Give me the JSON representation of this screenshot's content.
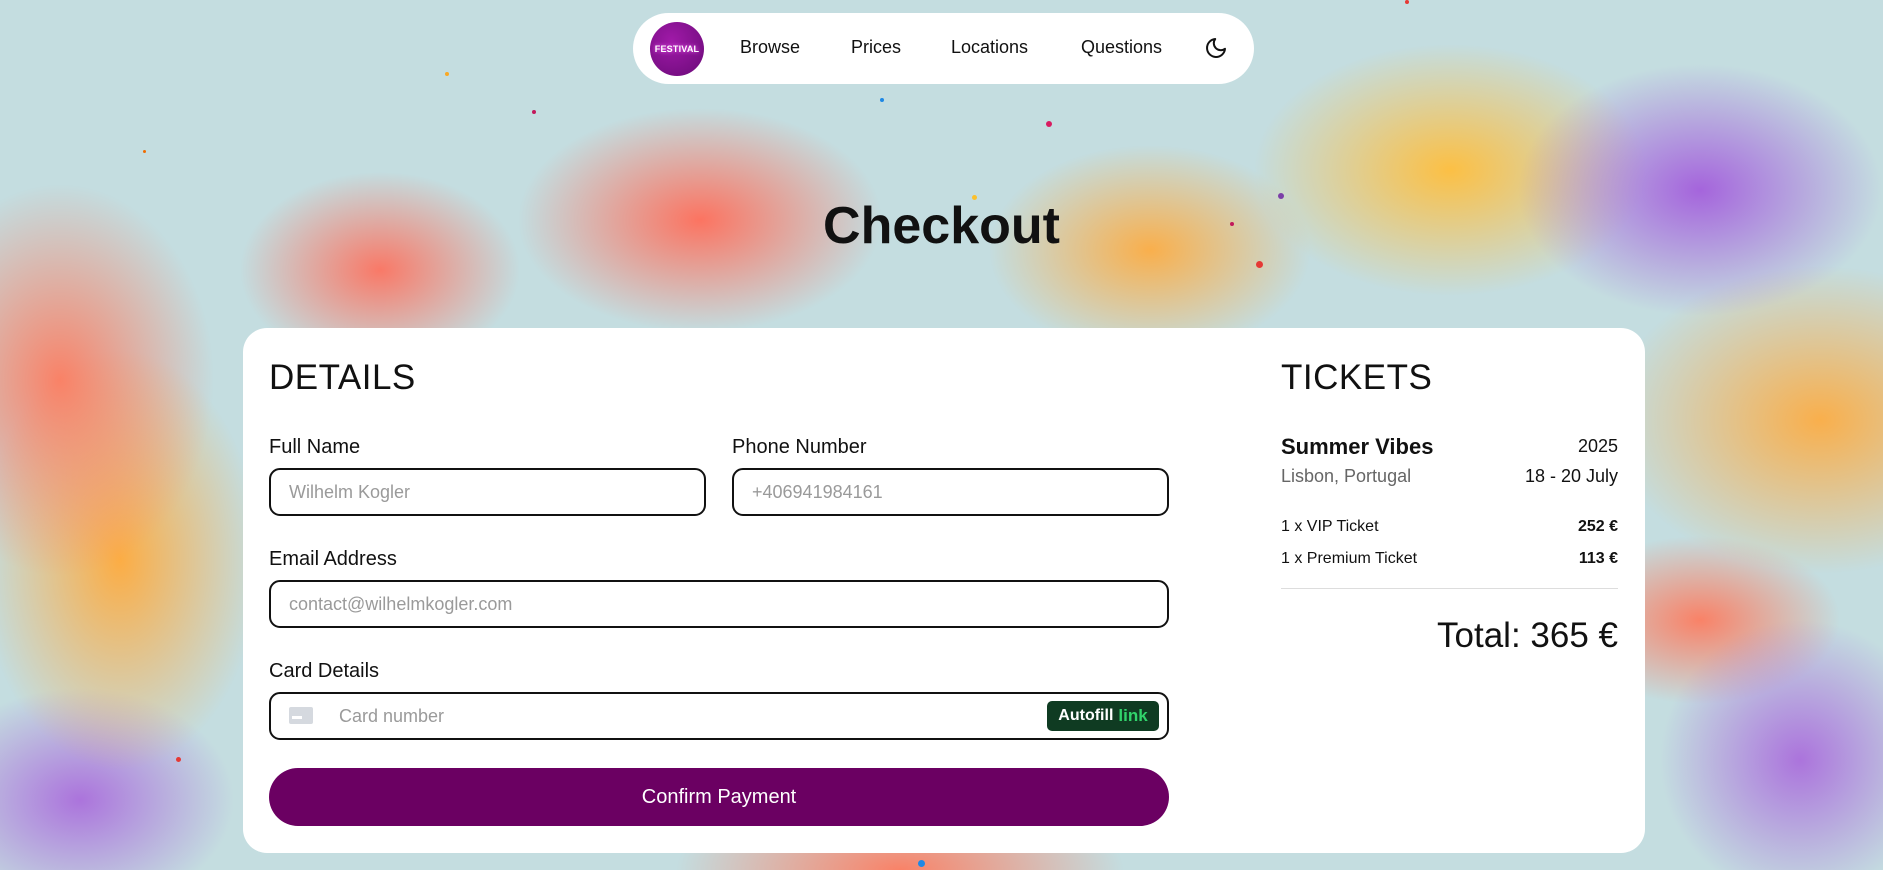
{
  "nav": {
    "logo_text": "FESTIVAL",
    "links": [
      "Browse",
      "Prices",
      "Locations",
      "Questions"
    ],
    "theme_icon": "moon-icon"
  },
  "page": {
    "title": "Checkout"
  },
  "details": {
    "title": "DETAILS",
    "full_name": {
      "label": "Full Name",
      "placeholder": "Wilhelm Kogler"
    },
    "phone": {
      "label": "Phone Number",
      "placeholder": "+406941984161"
    },
    "email": {
      "label": "Email Address",
      "placeholder": "contact@wilhelmkogler.com"
    },
    "card": {
      "label": "Card Details",
      "placeholder": "Card number",
      "autofill_text": "Autofill",
      "autofill_link": "link"
    },
    "confirm_label": "Confirm Payment"
  },
  "tickets": {
    "title": "TICKETS",
    "event_name": "Summer Vibes",
    "year": "2025",
    "location": "Lisbon, Portugal",
    "dates": "18 - 20 July",
    "items": [
      {
        "label": "1 x VIP Ticket",
        "price": "252 €"
      },
      {
        "label": "1 x Premium Ticket",
        "price": "113 €"
      }
    ],
    "total": "Total: 365 €"
  },
  "colors": {
    "accent": "#6b0062",
    "background": "#c4dde0",
    "link_green": "#31d46b"
  }
}
